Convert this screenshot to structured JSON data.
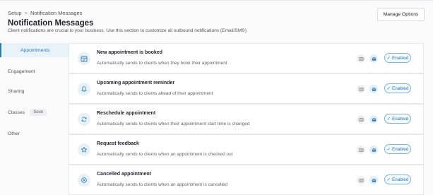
{
  "breadcrumb": {
    "parent": "Setup",
    "separator": ">",
    "current": "Notification Messages"
  },
  "page": {
    "title": "Notification Messages",
    "subtitle": "Client notifications are crucial to your business. Use this section to customize all outbound notifications (Email/SMS)"
  },
  "header": {
    "manage_label": "Manage Options"
  },
  "sidebar": {
    "items": [
      {
        "label": "Appointments",
        "active": true
      },
      {
        "label": "Engagement"
      },
      {
        "label": "Sharing"
      },
      {
        "label": "Classes",
        "badge": "Soon"
      },
      {
        "label": "Other"
      }
    ]
  },
  "notifications": [
    {
      "title": "New appointment is booked",
      "description": "Automatically sends to clients when they book their appointment",
      "icon": "calendar-icon",
      "status": "Enabled"
    },
    {
      "title": "Upcoming appointment reminder",
      "description": "Automatically sends to clients ahead of their appointment",
      "icon": "bell-icon",
      "status": "Enabled"
    },
    {
      "title": "Reschedule appointment",
      "description": "Automatically sends to clients when their appointment start time is changed",
      "icon": "refresh-icon",
      "status": "Enabled"
    },
    {
      "title": "Request feedback",
      "description": "Automatically sends to clients when an appointment is checked out",
      "icon": "star-icon",
      "status": "Enabled"
    },
    {
      "title": "Cancelled appointment",
      "description": "Automatically sends to clients when an appointment is cancelled",
      "icon": "cancel-icon",
      "status": "Enabled"
    }
  ],
  "colors": {
    "accent": "#2b7ab3",
    "active_bg": "#e8f2f9",
    "enabled_border": "#7fb3d8"
  }
}
